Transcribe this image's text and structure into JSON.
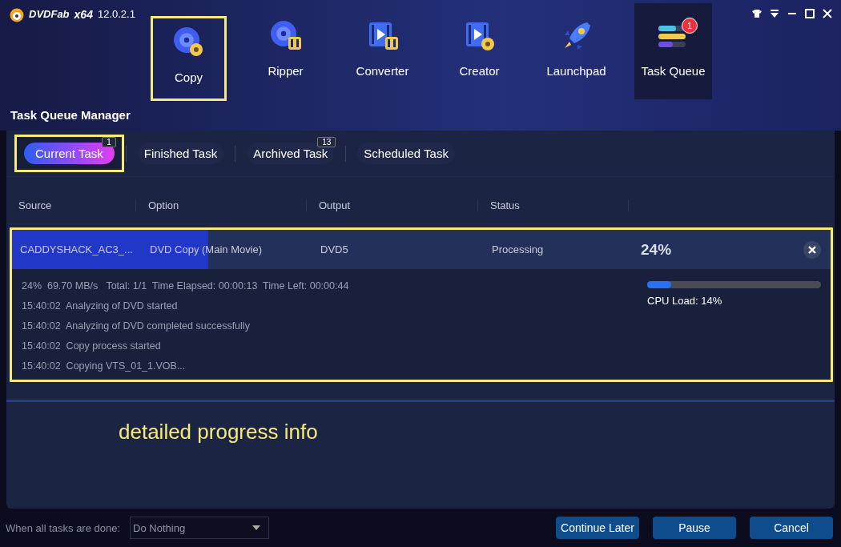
{
  "app": {
    "logo": "DVDFab",
    "arch": "x64",
    "version": "12.0.2.1"
  },
  "modules": [
    {
      "label": "Copy",
      "kind": "disc",
      "selected": false,
      "highlighted": true
    },
    {
      "label": "Ripper",
      "kind": "disc-film",
      "selected": false,
      "highlighted": false
    },
    {
      "label": "Converter",
      "kind": "film",
      "selected": false,
      "highlighted": false
    },
    {
      "label": "Creator",
      "kind": "film-disc",
      "selected": false,
      "highlighted": false
    },
    {
      "label": "Launchpad",
      "kind": "rocket",
      "selected": false,
      "highlighted": false
    },
    {
      "label": "Task Queue",
      "kind": "bars",
      "selected": true,
      "highlighted": false,
      "badge": "1"
    }
  ],
  "page_title": "Task Queue Manager",
  "tabs": [
    {
      "label": "Current Task",
      "selected": true,
      "highlighted": true,
      "count": "1"
    },
    {
      "label": "Finished Task",
      "selected": false,
      "highlighted": false
    },
    {
      "label": "Archived Task",
      "selected": false,
      "highlighted": false,
      "count": "13"
    },
    {
      "label": "Scheduled Task",
      "selected": false,
      "highlighted": false
    }
  ],
  "table": {
    "columns": [
      "Source",
      "Option",
      "Output",
      "Status"
    ],
    "rows": [
      {
        "source": "CADDYSHACK_AC3_...",
        "option": "DVD Copy (Main Movie)",
        "output": "DVD5",
        "status": "Processing",
        "percent": "24%",
        "level": 0.24,
        "highlighted": true,
        "summary": "24%  69.70 MB/s   Total: 1/1  Time Elapsed: 00:00:13  Time Left: 00:00:44",
        "log": [
          "15:40:02  Analyzing of DVD started",
          "15:40:02  Analyzing of DVD completed successfully",
          "15:40:02  Copy process started",
          "15:40:02  Copying VTS_01_1.VOB..."
        ],
        "cpu": {
          "level": 0.14,
          "label": "CPU Load: 14%"
        }
      }
    ]
  },
  "annotation": "detailed progress info",
  "footer": {
    "label": "When all tasks are done:",
    "select": "Do Nothing",
    "buttons": [
      "Continue Later",
      "Pause",
      "Cancel"
    ]
  }
}
